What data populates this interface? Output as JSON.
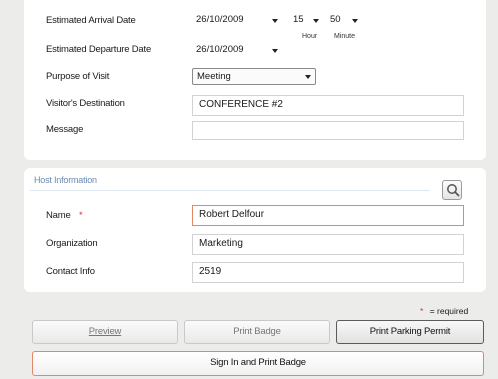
{
  "visit": {
    "arrival_label": "Estimated Arrival Date",
    "arrival_date": "26/10/2009",
    "arrival_hour": "15",
    "arrival_minute": "50",
    "hour_caption": "Hour",
    "minute_caption": "Minute",
    "departure_label": "Estimated Departure Date",
    "departure_date": "26/10/2009",
    "purpose_label": "Purpose of Visit",
    "purpose_value": "Meeting",
    "destination_label": "Visitor's Destination",
    "destination_value": "CONFERENCE #2",
    "message_label": "Message",
    "message_value": ""
  },
  "host": {
    "section_title": "Host Information",
    "name_label": "Name",
    "name_required_mark": "*",
    "name_value": "Robert Delfour",
    "organization_label": "Organization",
    "organization_value": "Marketing",
    "contact_label": "Contact Info",
    "contact_value": "2519"
  },
  "footer": {
    "required_mark": "*",
    "required_text": "= required",
    "preview_label": "Preview",
    "print_badge_label": "Print Badge",
    "print_parking_label": "Print Parking Permit",
    "sign_in_label": "Sign In and Print Badge"
  },
  "colors": {
    "required": "#e0302a",
    "active_border": "#e08868",
    "section_title": "#6a8ab0"
  }
}
